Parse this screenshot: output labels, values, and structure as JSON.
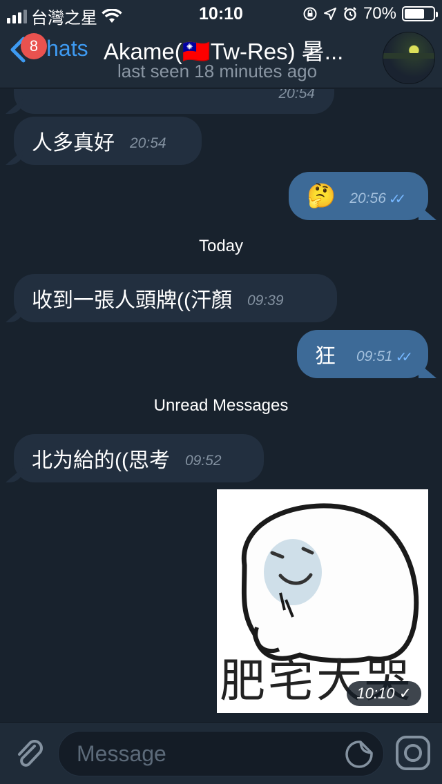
{
  "status_bar": {
    "carrier": "台灣之星",
    "time": "10:10",
    "battery": "70%",
    "battery_level": 0.7
  },
  "header": {
    "back_label": "Chats",
    "unread_badge": "8",
    "title": "Akame(🇹🇼Tw-Res) 暑...",
    "subtitle": "last seen 18 minutes ago"
  },
  "messages": [
    {
      "direction": "in",
      "text": "",
      "time": "20:54"
    },
    {
      "direction": "in",
      "text": "人多真好",
      "time": "20:54"
    },
    {
      "direction": "out",
      "text": "🤔",
      "time": "20:56",
      "status": "read"
    },
    {
      "direction": "in",
      "text": "收到一張人頭牌((汗顏",
      "time": "09:39"
    },
    {
      "direction": "out",
      "text": "狂",
      "time": "09:51",
      "status": "read"
    },
    {
      "direction": "in",
      "text": "北为給的((思考",
      "time": "09:52"
    },
    {
      "direction": "out",
      "type": "sticker",
      "caption": "肥宅大哭",
      "time": "10:10",
      "status": "sent"
    }
  ],
  "separators": {
    "today": "Today",
    "unread": "Unread Messages"
  },
  "input": {
    "placeholder": "Message"
  },
  "icons": {
    "back": "chevron-left-icon",
    "attach": "paperclip-icon",
    "sticker": "sticker-icon",
    "camera": "camera-icon",
    "wifi": "wifi-icon",
    "location": "location-arrow-icon",
    "alarm": "alarm-icon",
    "lock": "rotation-lock-icon"
  },
  "colors": {
    "accent": "#3e9af1",
    "outgoing": "#3d6a97",
    "incoming": "#222f3f",
    "background": "#18222d",
    "badge": "#e9524f"
  }
}
